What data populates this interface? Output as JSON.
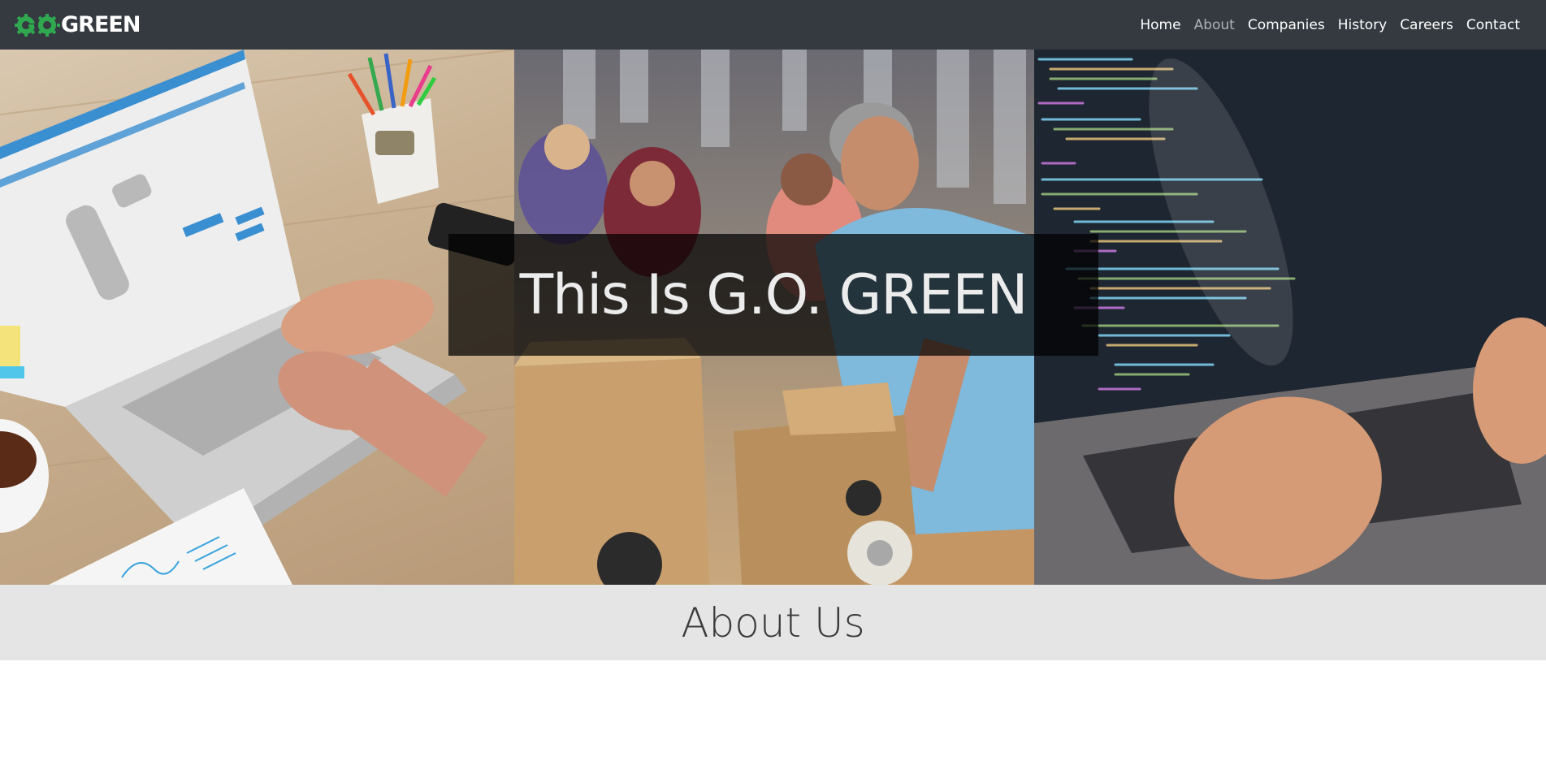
{
  "brand": {
    "go": "GO",
    "name": "GREEN",
    "colors": {
      "green": "#2fa84f",
      "white": "#ffffff"
    }
  },
  "nav": {
    "items": [
      {
        "label": "Home",
        "active": false
      },
      {
        "label": "About",
        "active": true
      },
      {
        "label": "Companies",
        "active": false
      },
      {
        "label": "History",
        "active": false
      },
      {
        "label": "Careers",
        "active": false
      },
      {
        "label": "Contact",
        "active": false
      }
    ]
  },
  "hero": {
    "title": "This Is G.O. GREEN",
    "panels": [
      "laptop-shopping-photo",
      "warehouse-packing-photo",
      "code-laptop-photo"
    ]
  },
  "about": {
    "title": "About Us"
  },
  "colors": {
    "navbar": "#343a40",
    "about_band": "#e5e5e5"
  }
}
